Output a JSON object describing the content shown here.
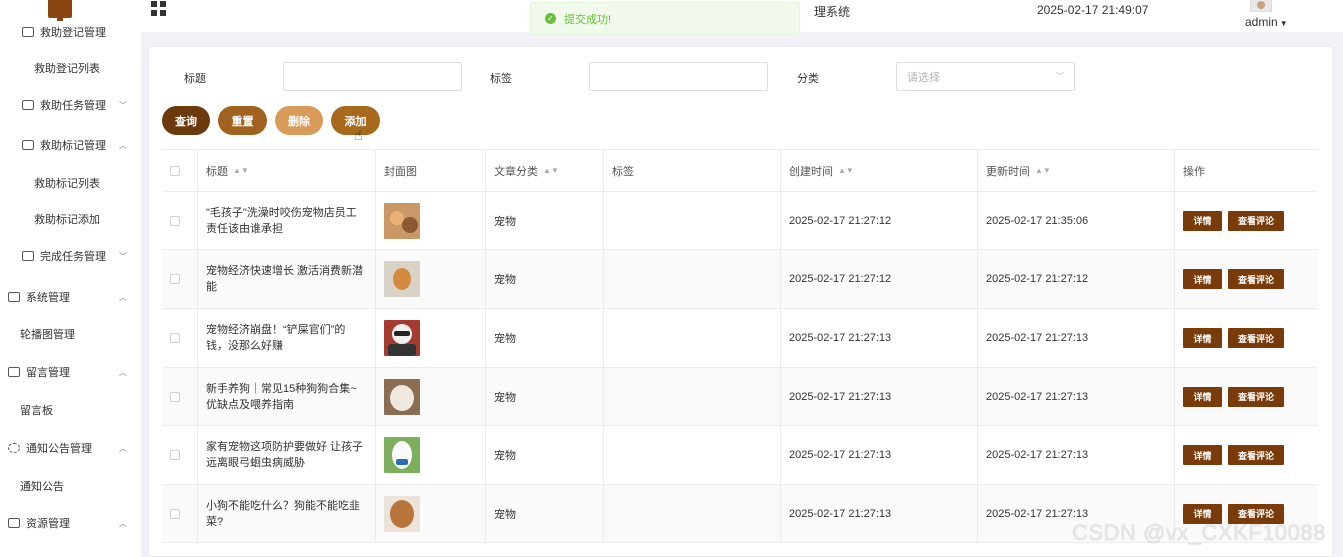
{
  "header": {
    "system_title": "理系统",
    "datetime": "2025-02-17 21:49:07",
    "user": "admin"
  },
  "toast": {
    "message": "提交成功!"
  },
  "sidebar": {
    "items": [
      {
        "label": "救助登记管理",
        "type": "group"
      },
      {
        "label": "救助登记列表",
        "type": "sub"
      },
      {
        "label": "救助任务管理",
        "type": "group"
      },
      {
        "label": "救助标记管理",
        "type": "group"
      },
      {
        "label": "救助标记列表",
        "type": "sub"
      },
      {
        "label": "救助标记添加",
        "type": "sub"
      },
      {
        "label": "完成任务管理",
        "type": "group"
      },
      {
        "label": "系统管理",
        "type": "top"
      },
      {
        "label": "轮播图管理",
        "type": "sub2"
      },
      {
        "label": "留言管理",
        "type": "top"
      },
      {
        "label": "留言板",
        "type": "sub2"
      },
      {
        "label": "通知公告管理",
        "type": "top"
      },
      {
        "label": "通知公告",
        "type": "sub2"
      },
      {
        "label": "资源管理",
        "type": "top"
      }
    ]
  },
  "filters": {
    "title_label": "标题",
    "title_value": "",
    "tag_label": "标签",
    "tag_value": "",
    "category_label": "分类",
    "category_placeholder": "请选择"
  },
  "buttons": {
    "query": "查询",
    "reset": "重置",
    "delete": "删除",
    "add": "添加"
  },
  "colors": {
    "query": "#6b3a0c",
    "reset": "#a0621e",
    "delete": "#d99b5a",
    "add": "#a76a1d",
    "action": "#7a3b0a"
  },
  "table": {
    "columns": {
      "title": "标题",
      "cover": "封面图",
      "category": "文章分类",
      "tag": "标签",
      "created": "创建时间",
      "updated": "更新时间",
      "actions": "操作"
    },
    "rows": [
      {
        "title": "\"毛孩子\"洗澡时咬伤宠物店员工 责任该由谁承担",
        "cover": "cat-and-dog-photo",
        "category": "宠物",
        "tag": "",
        "created": "2025-02-17 21:27:12",
        "updated": "2025-02-17 21:35:06"
      },
      {
        "title": "宠物经济快速增长 激活消费新潜能",
        "cover": "shiba-dog-photo",
        "category": "宠物",
        "tag": "",
        "created": "2025-02-17 21:27:12",
        "updated": "2025-02-17 21:27:12"
      },
      {
        "title": "宠物经济崩盘！“铲屎官们”的钱，没那么好赚",
        "cover": "dog-with-sunglasses-photo",
        "category": "宠物",
        "tag": "",
        "created": "2025-02-17 21:27:13",
        "updated": "2025-02-17 21:27:13"
      },
      {
        "title": "新手养狗｜常见15种狗狗合集~优缺点及喂养指南",
        "cover": "fluffy-dog-photo",
        "category": "宠物",
        "tag": "",
        "created": "2025-02-17 21:27:13",
        "updated": "2025-02-17 21:27:13"
      },
      {
        "title": "家有宠物这项防护要做好 让孩子远离眼弓蛔虫病威胁",
        "cover": "white-dog-photo",
        "category": "宠物",
        "tag": "",
        "created": "2025-02-17 21:27:13",
        "updated": "2025-02-17 21:27:13"
      },
      {
        "title": "小狗不能吃什么？狗能不能吃韭菜?",
        "cover": "poodle-photo",
        "category": "宠物",
        "tag": "",
        "created": "2025-02-17 21:27:13",
        "updated": "2025-02-17 21:27:13"
      }
    ],
    "detail_label": "详情",
    "comments_label": "查看评论"
  },
  "watermark": "CSDN @vx_CXKF10088"
}
